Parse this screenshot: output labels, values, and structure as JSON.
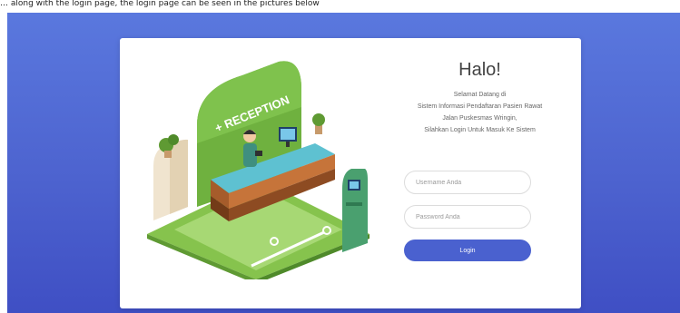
{
  "caption": "… along with the login page, the login page can be seen in the pictures below",
  "login": {
    "title": "Halo!",
    "subtitle_lines": [
      "Selamat Datang di",
      "Sistem Informasi Pendaftaran Pasien Rawat",
      "Jalan Puskesmas Wringin,",
      "Silahkan Login Untuk Masuk Ke Sistem"
    ],
    "username_placeholder": "Username Anda",
    "password_placeholder": "Password Anda",
    "button_label": "Login"
  },
  "illustration": {
    "sign_text": "+ RECEPTION"
  },
  "colors": {
    "background": "#4e66d3",
    "button": "#4a61cf",
    "green": "#7bbf46"
  }
}
